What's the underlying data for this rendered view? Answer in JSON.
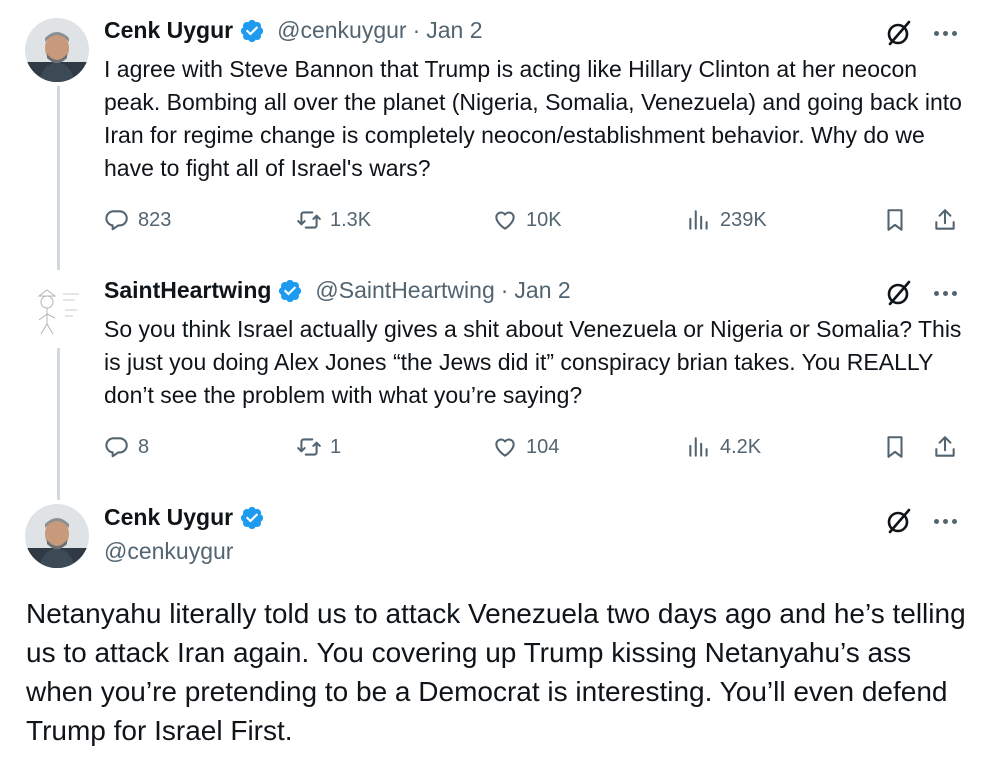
{
  "posts": [
    {
      "name": "Cenk Uygur",
      "handle": "@cenkuygur",
      "separator": "·",
      "date": "Jan 2",
      "text": "I agree with Steve Bannon that Trump is acting like Hillary Clinton at her neocon peak. Bombing all over the planet (Nigeria, Somalia, Venezuela) and going back into Iran for regime change is completely neocon/establishment behavior. Why do we have to fight all of Israel's wars?",
      "replies": "823",
      "reposts": "1.3K",
      "likes": "10K",
      "views": "239K"
    },
    {
      "name": "SaintHeartwing",
      "handle": "@SaintHeartwing",
      "separator": "·",
      "date": "Jan 2",
      "text": "So you think Israel actually gives a shit about Venezuela or Nigeria or Somalia? This is just you doing Alex Jones “the Jews did it” conspiracy brian takes. You REALLY don’t see the problem with what you’re saying?",
      "replies": "8",
      "reposts": "1",
      "likes": "104",
      "views": "4.2K"
    }
  ],
  "main_post": {
    "name": "Cenk Uygur",
    "handle": "@cenkuygur",
    "text": "Netanyahu literally told us to attack Venezuela two days ago and he’s telling us to attack Iran again. You covering up Trump kissing Netanyahu’s ass when you’re pretending to be a Democrat is interesting. You’ll even defend Trump for Israel First."
  },
  "colors": {
    "verified_badge": "#1d9bf0",
    "secondary_text": "#536471",
    "thread_line": "#cfd9de"
  },
  "icons": [
    "verified-badge-icon",
    "grok-icon",
    "more-icon",
    "reply-icon",
    "repost-icon",
    "like-icon",
    "views-icon",
    "bookmark-icon",
    "share-icon"
  ]
}
